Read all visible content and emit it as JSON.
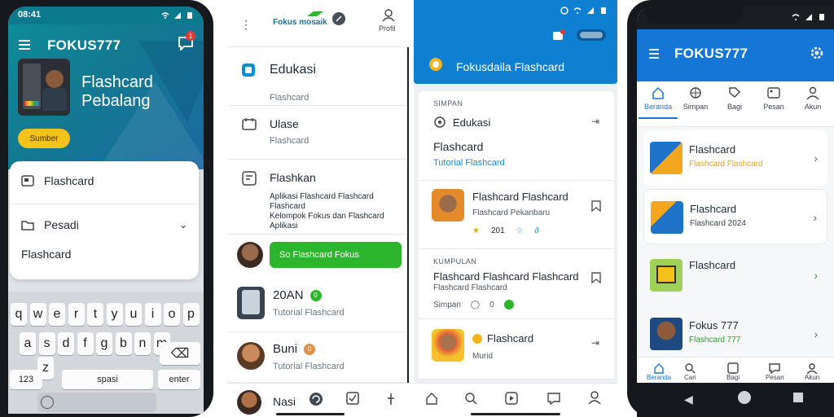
{
  "phone1": {
    "status_time": "08:41",
    "brand": "FOKUS777",
    "hero_title_line1": "Flashcard",
    "hero_title_line2": "Pebalang",
    "cta_label": "Sumber",
    "card_item1": "Flashcard",
    "card_item2": "Pesadi",
    "card_item3": "Flashcard",
    "keyboard_row1": [
      "q",
      "w",
      "e",
      "r",
      "t",
      "y",
      "u",
      "i",
      "o",
      "p"
    ],
    "keyboard_row2": [
      "a",
      "s",
      "d",
      "f",
      "g",
      "b",
      "n",
      "m"
    ],
    "key_num": "123",
    "key_space": "spasi",
    "key_enter": "enter",
    "notif_count": "1"
  },
  "phone2": {
    "top_brand": "Fokus mosaik",
    "top_profile": "Profil",
    "section1_title": "Edukasi",
    "section1_sub": "Flashcard",
    "section2_title": "Ulase",
    "section2_sub": "Flashcard",
    "section3_title": "Flashkan",
    "section3_desc_line1": "Aplikasi Flashcard Flashcard Flashcard",
    "section3_desc_line2": "Kelompok Fokus dan Flashcard",
    "section3_desc_line3": "Aplikasi",
    "pill_label": "So Flashcard Fokus",
    "row4_title": "20AN",
    "row4_sub": "Tutorial Flashcard",
    "row5_title": "Buni",
    "row5_sub": "Tutorial Flashcard",
    "bottom_name": "Nasi",
    "badge4": "0",
    "badge5": "0"
  },
  "phone3": {
    "header_title": "Fokusdaila Flashcard",
    "section_label": "SIMPAN",
    "edu_title": "Edukasi",
    "flash_title": "Flashcard",
    "flash_link": "Tutorial Flashcard",
    "item1_title": "Flashcard Flashcard",
    "item1_sub": "Flashcard Pekanbaru",
    "item1_meta1": "201",
    "item2_label": "KUMPULAN",
    "item2_title": "Flashcard Flashcard Flashcard",
    "item2_sub": "Flashcard Flashcard",
    "item2_meta": "Simpan",
    "item2_meta2": "0",
    "item3_title": "Flashcard",
    "item3_sub": "Murid"
  },
  "phone4": {
    "brand": "FOKUS777",
    "tabs": [
      "Beranda",
      "Simpan",
      "Bagi",
      "Pesan",
      "Akun"
    ],
    "items": [
      {
        "title": "Flashcard",
        "sub": "Flashcard Flashcard",
        "sub_color": "#e0a412"
      },
      {
        "title": "Flashcard",
        "sub": "Flashcard 2024",
        "sub_color": "#39424b"
      },
      {
        "title": "Flashcard",
        "sub": "",
        "sub_color": "#39424b"
      },
      {
        "title": "Fokus 777",
        "sub": "Flashcard 777",
        "sub_color": "#2aa52a"
      }
    ],
    "bnav": [
      "Beranda",
      "Cari",
      "Bagi",
      "Pesan",
      "Akun"
    ]
  },
  "colors": {
    "teal": "#0e8b98",
    "blue": "#0f7fd2",
    "green": "#2db52d",
    "yellow": "#f3c21b"
  }
}
